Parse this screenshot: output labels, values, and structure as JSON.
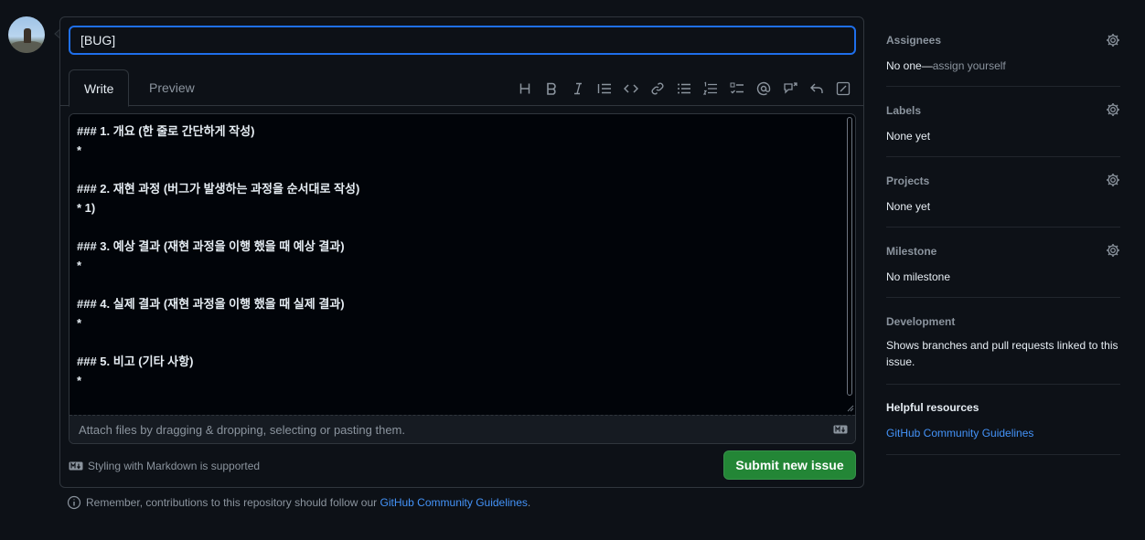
{
  "colors": {
    "background": "#0d1117",
    "accent_blue": "#1f6feb",
    "link": "#4493f8",
    "submit_green": "#238636",
    "muted": "#8b949e",
    "text": "#e6edf3"
  },
  "issue": {
    "title_value": "[BUG]"
  },
  "tabs": {
    "write": "Write",
    "preview": "Preview"
  },
  "toolbar_icons": [
    "heading-icon",
    "bold-icon",
    "italic-icon",
    "quote-icon",
    "code-icon",
    "link-icon",
    "unordered-list-icon",
    "ordered-list-icon",
    "task-list-icon",
    "mention-icon",
    "cross-reference-icon",
    "reply-icon",
    "fullscreen-icon"
  ],
  "editor": {
    "body": "### 1. 개요 (한 줄로 간단하게 작성)\n*\n\n### 2. 재현 과정 (버그가 발생하는 과정을 순서대로 작성)\n* 1)\n\n### 3. 예상 결과 (재현 과정을 이행 했을 때 예상 결과)\n*\n\n### 4. 실제 결과 (재현 과정을 이행 했을 때 실제 결과)\n*\n\n### 5. 비고 (기타 사항)\n*",
    "attach_hint": "Attach files by dragging & dropping, selecting or pasting them."
  },
  "footer": {
    "markdown_note": "Styling with Markdown is supported",
    "submit_label": "Submit new issue",
    "remember_text": "Remember, contributions to this repository should follow our ",
    "remember_link": "GitHub Community Guidelines",
    "remember_end": "."
  },
  "sidebar": {
    "assignees": {
      "heading": "Assignees",
      "value": "No one—",
      "action": "assign yourself"
    },
    "labels": {
      "heading": "Labels",
      "value": "None yet"
    },
    "projects": {
      "heading": "Projects",
      "value": "None yet"
    },
    "milestone": {
      "heading": "Milestone",
      "value": "No milestone"
    },
    "development": {
      "heading": "Development",
      "value": "Shows branches and pull requests linked to this issue."
    },
    "helpful": {
      "heading": "Helpful resources",
      "link": "GitHub Community Guidelines"
    }
  }
}
